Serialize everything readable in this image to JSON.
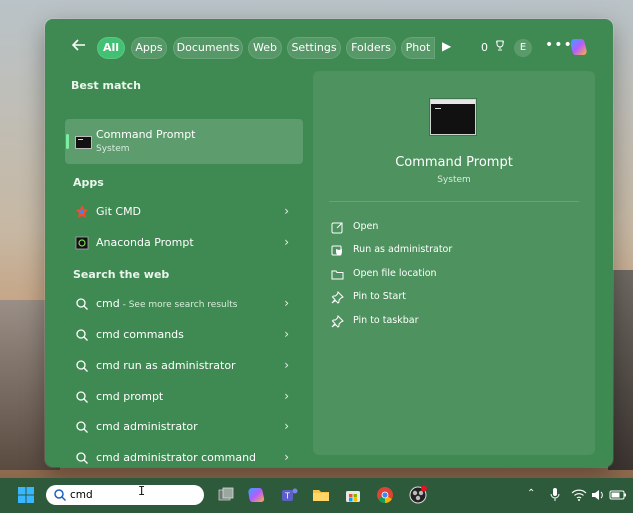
{
  "filter_bar": {
    "tabs": [
      {
        "label": "All",
        "active": true
      },
      {
        "label": "Apps"
      },
      {
        "label": "Documents"
      },
      {
        "label": "Web"
      },
      {
        "label": "Settings"
      },
      {
        "label": "Folders"
      },
      {
        "label": "Phot"
      }
    ],
    "score": "0"
  },
  "avatar_letter": "E",
  "left_pane": {
    "best_match_header": "Best match",
    "best_match": {
      "title": "Command Prompt",
      "subtitle": "System"
    },
    "apps_header": "Apps",
    "apps": [
      {
        "label": "Git CMD",
        "icon": "git-icon"
      },
      {
        "label": "Anaconda Prompt",
        "icon": "anaconda-icon"
      }
    ],
    "web_header": "Search the web",
    "web_results": [
      {
        "label": "cmd",
        "sub": " - See more search results"
      },
      {
        "label": "cmd commands"
      },
      {
        "label": "cmd run as administrator"
      },
      {
        "label": "cmd prompt"
      },
      {
        "label": "cmd administrator"
      },
      {
        "label": "cmd administrator command"
      }
    ]
  },
  "preview": {
    "title": "Command Prompt",
    "subtitle": "System",
    "actions": [
      {
        "label": "Open",
        "icon": "open-icon"
      },
      {
        "label": "Run as administrator",
        "icon": "shield-icon"
      },
      {
        "label": "Open file location",
        "icon": "folder-icon"
      },
      {
        "label": "Pin to Start",
        "icon": "pin-icon"
      },
      {
        "label": "Pin to taskbar",
        "icon": "pin-icon"
      }
    ]
  },
  "taskbar": {
    "search_value": "cmd"
  },
  "colors": {
    "panel": "#3f8a52",
    "active_chip": "#43c173",
    "taskbar": "#2c5a3b"
  }
}
